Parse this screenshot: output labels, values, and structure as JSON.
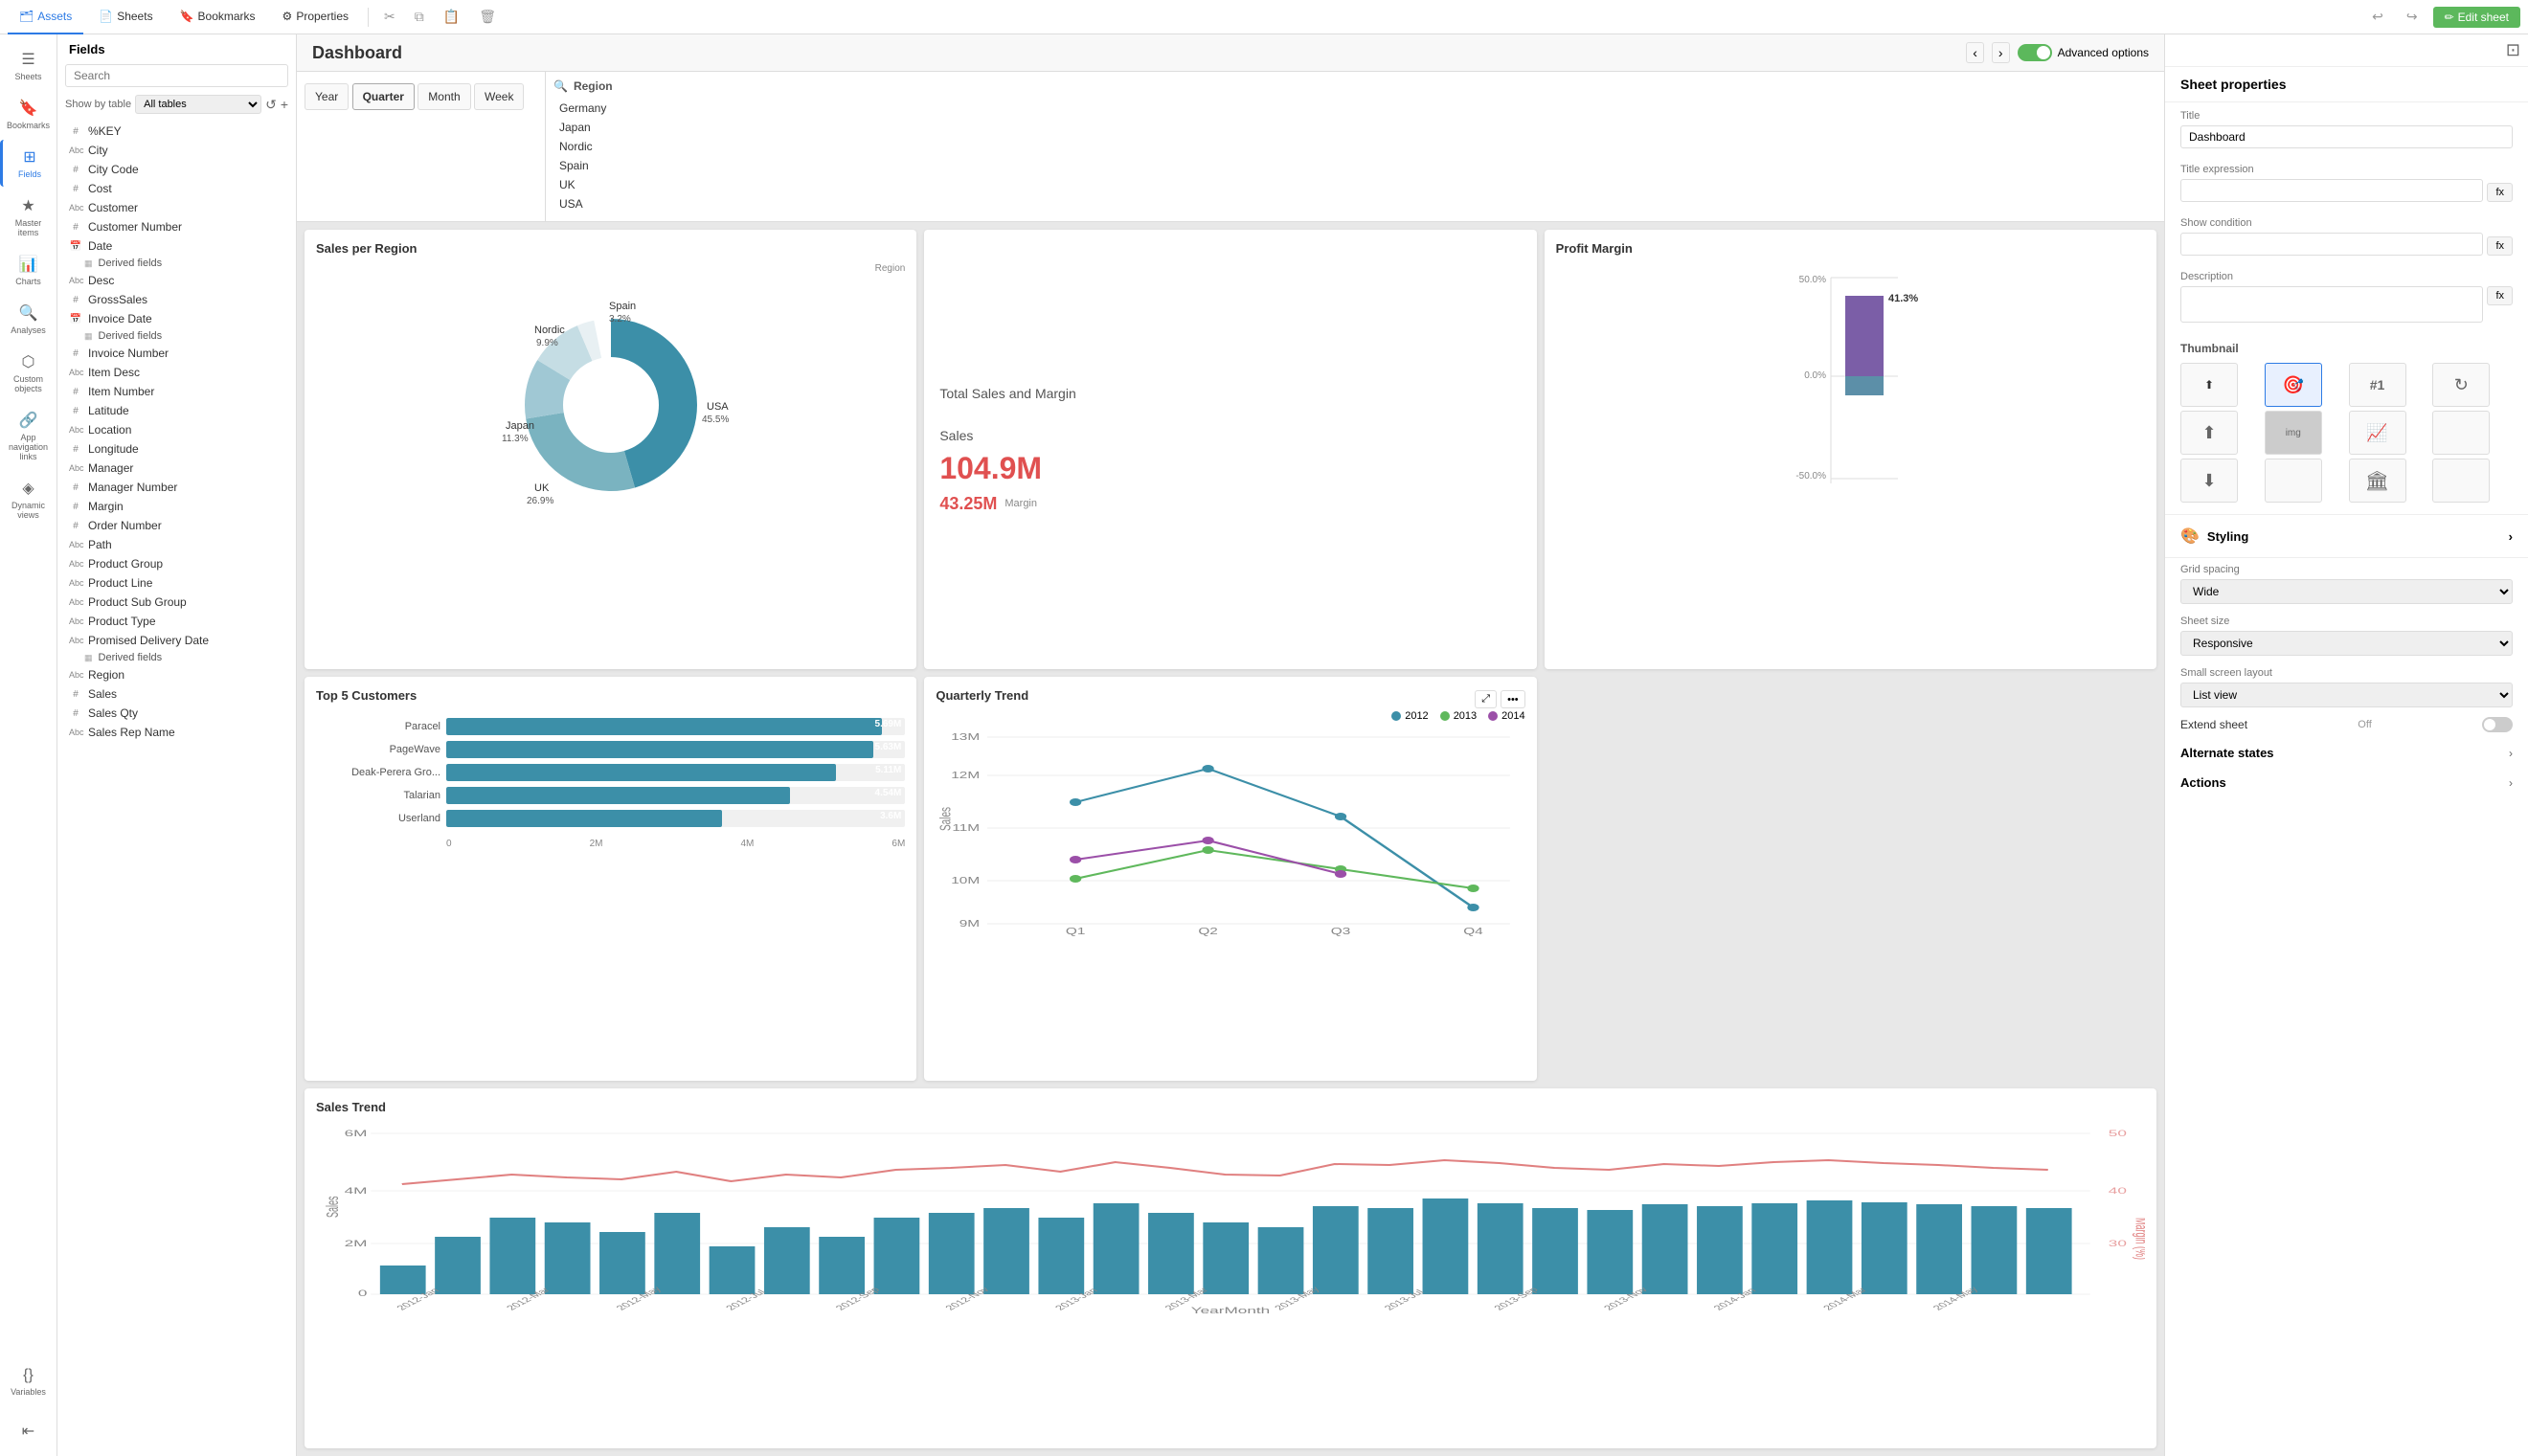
{
  "topbar": {
    "tabs": [
      {
        "label": "Assets",
        "icon": "🗂",
        "active": true
      },
      {
        "label": "Sheets",
        "icon": "📄",
        "active": false
      },
      {
        "label": "Bookmarks",
        "icon": "🔖",
        "active": false
      },
      {
        "label": "Properties",
        "icon": "⚙",
        "active": false
      }
    ],
    "edit_sheet_label": "Edit sheet",
    "undo_icon": "↩",
    "redo_icon": "↪"
  },
  "icon_sidebar": {
    "items": [
      {
        "label": "Sheets",
        "icon": "☰",
        "active": false
      },
      {
        "label": "Bookmarks",
        "icon": "🔖",
        "active": false
      },
      {
        "label": "Fields",
        "icon": "⊞",
        "active": true
      },
      {
        "label": "Master items",
        "icon": "★",
        "active": false
      },
      {
        "label": "Charts",
        "icon": "📊",
        "active": false
      },
      {
        "label": "Analyses",
        "icon": "🔍",
        "active": false
      },
      {
        "label": "Custom objects",
        "icon": "⬡",
        "active": false
      },
      {
        "label": "App navigation links",
        "icon": "🔗",
        "active": false
      },
      {
        "label": "Dynamic views",
        "icon": "◈",
        "active": false
      },
      {
        "label": "Variables",
        "icon": "{}",
        "active": false
      }
    ]
  },
  "fields_panel": {
    "title": "Fields",
    "search_placeholder": "Search",
    "show_by_table_label": "Show by table",
    "all_tables_option": "All tables",
    "fields": [
      {
        "type": "#",
        "name": "%KEY"
      },
      {
        "type": "Abc",
        "name": "City"
      },
      {
        "type": "#",
        "name": "City Code"
      },
      {
        "type": "#",
        "name": "Cost"
      },
      {
        "type": "Abc",
        "name": "Customer"
      },
      {
        "type": "#",
        "name": "Customer Number"
      },
      {
        "type": "📅",
        "name": "Date",
        "derived": true
      },
      {
        "type": "Abc",
        "name": "Desc"
      },
      {
        "type": "#",
        "name": "GrossSales"
      },
      {
        "type": "📅",
        "name": "Invoice Date",
        "derived": true
      },
      {
        "type": "#",
        "name": "Invoice Number"
      },
      {
        "type": "Abc",
        "name": "Item Desc"
      },
      {
        "type": "#",
        "name": "Item Number"
      },
      {
        "type": "#",
        "name": "Latitude"
      },
      {
        "type": "Abc",
        "name": "Location"
      },
      {
        "type": "#",
        "name": "Longitude"
      },
      {
        "type": "Abc",
        "name": "Manager"
      },
      {
        "type": "#",
        "name": "Manager Number"
      },
      {
        "type": "#",
        "name": "Margin"
      },
      {
        "type": "#",
        "name": "Order Number"
      },
      {
        "type": "Abc",
        "name": "Path"
      },
      {
        "type": "Abc",
        "name": "Product Group"
      },
      {
        "type": "Abc",
        "name": "Product Line"
      },
      {
        "type": "Abc",
        "name": "Product Sub Group"
      },
      {
        "type": "Abc",
        "name": "Product Type"
      },
      {
        "type": "Abc",
        "name": "Promised Delivery Date",
        "derived": true
      },
      {
        "type": "Abc",
        "name": "Region"
      },
      {
        "type": "#",
        "name": "Sales"
      },
      {
        "type": "#",
        "name": "Sales Qty"
      },
      {
        "type": "Abc",
        "name": "Sales Rep Name"
      }
    ]
  },
  "dashboard": {
    "title": "Dashboard",
    "advanced_options_label": "Advanced options",
    "filters": {
      "buttons": [
        "Year",
        "Quarter",
        "Month",
        "Week"
      ],
      "region_label": "Region",
      "region_items": [
        "Germany",
        "Japan",
        "Nordic",
        "Spain",
        "UK",
        "USA"
      ]
    },
    "charts": {
      "sales_per_region": {
        "title": "Sales per Region",
        "legend_label": "Region",
        "segments": [
          {
            "label": "USA",
            "value": 45.5,
            "color": "#3c8fa8"
          },
          {
            "label": "UK",
            "value": 26.9,
            "color": "#7ab3c0"
          },
          {
            "label": "Japan",
            "value": 11.3,
            "color": "#a0c8d4"
          },
          {
            "label": "Nordic",
            "value": 9.9,
            "color": "#c5dde4"
          },
          {
            "label": "Spain",
            "value": 3.2,
            "color": "#e8f0f3"
          }
        ]
      },
      "top5_customers": {
        "title": "Top 5 Customers",
        "bars": [
          {
            "label": "Paracel",
            "value": 5.69,
            "display": "5.69M"
          },
          {
            "label": "PageWave",
            "value": 5.63,
            "display": "5.63M"
          },
          {
            "label": "Deak-Perera Gro...",
            "value": 5.11,
            "display": "5.11M"
          },
          {
            "label": "Talarian",
            "value": 4.54,
            "display": "4.54M"
          },
          {
            "label": "Userland",
            "value": 3.6,
            "display": "3.6M"
          }
        ],
        "x_labels": [
          "0",
          "2M",
          "4M",
          "6M"
        ]
      },
      "total_sales_margin": {
        "title": "Total Sales and Margin",
        "sales_label": "Sales",
        "sales_value": "104.9M",
        "margin_value": "43.25M",
        "margin_label": "Margin"
      },
      "profit_margin": {
        "title": "Profit Margin",
        "value": "41.3%",
        "y_labels": [
          "50.0%",
          "0.0%",
          "-50.0%"
        ]
      },
      "quarterly_trend": {
        "title": "Quarterly Trend",
        "y_labels": [
          "13M",
          "12M",
          "11M",
          "10M",
          "9M"
        ],
        "x_labels": [
          "Q1",
          "Q2",
          "Q3",
          "Q4"
        ],
        "legend": [
          {
            "year": "2012",
            "color": "#3c8fa8"
          },
          {
            "year": "2013",
            "color": "#5fb85c"
          },
          {
            "year": "2014",
            "color": "#9b4fa8"
          }
        ],
        "y_axis_label": "Sales"
      },
      "sales_trend": {
        "title": "Sales Trend",
        "y_labels": [
          "6M",
          "4M",
          "2M",
          "0"
        ],
        "y_right_labels": [
          "50",
          "40",
          "30"
        ],
        "x_axis_label": "YearMonth",
        "y_axis_label": "Sales",
        "y_right_label": "Margin (%)"
      }
    }
  },
  "right_panel": {
    "title": "Sheet properties",
    "title_label": "Title",
    "title_value": "Dashboard",
    "title_expression_label": "Title expression",
    "show_condition_label": "Show condition",
    "description_label": "Description",
    "thumbnail_label": "Thumbnail",
    "styling_label": "Styling",
    "grid_spacing_label": "Grid spacing",
    "grid_spacing_value": "Wide",
    "sheet_size_label": "Sheet size",
    "sheet_size_value": "Responsive",
    "small_screen_label": "Small screen layout",
    "small_screen_value": "List view",
    "extend_sheet_label": "Extend sheet",
    "extend_sheet_value": "Off",
    "alternate_states_label": "Alternate states",
    "actions_label": "Actions"
  }
}
